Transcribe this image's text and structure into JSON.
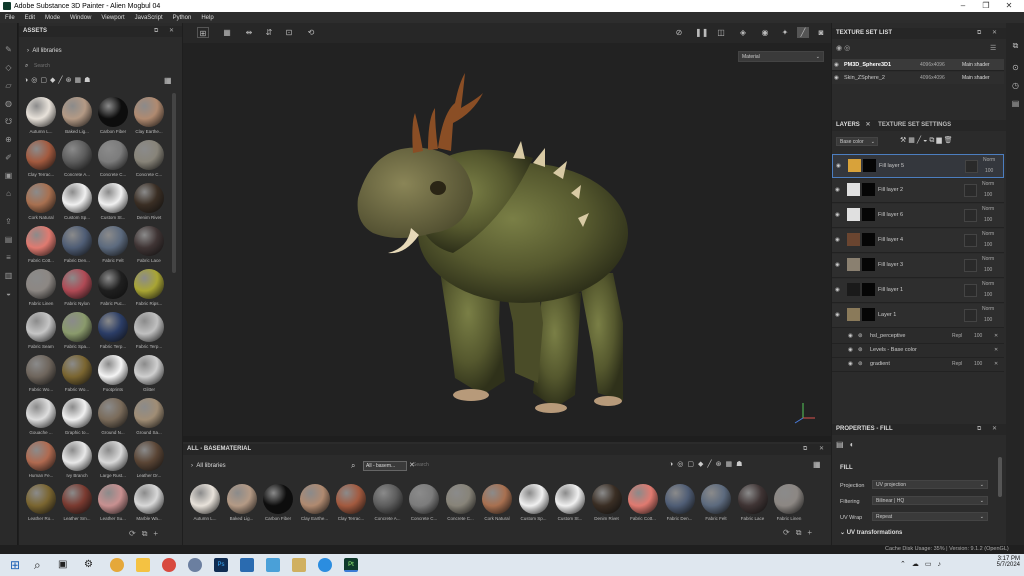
{
  "window": {
    "title": "Adobe Substance 3D Painter - Alien Mogbul 04"
  },
  "menu": [
    "File",
    "Edit",
    "Mode",
    "Window",
    "Viewport",
    "JavaScript",
    "Python",
    "Help"
  ],
  "assets": {
    "title": "ASSETS",
    "library": "All libraries",
    "search_placeholder": "Search",
    "items": [
      {
        "label": "Autumn L...",
        "color": "#e8e2da"
      },
      {
        "label": "Baked Lig...",
        "color": "#b49a85"
      },
      {
        "label": "Carbon Fiber",
        "color": "#0d0d0d"
      },
      {
        "label": "Clay Earthe...",
        "color": "#b08a70"
      },
      {
        "label": "Clay Terrac...",
        "color": "#a35a3f"
      },
      {
        "label": "Concrete A...",
        "color": "#5d5d5d"
      },
      {
        "label": "Concrete C...",
        "color": "#7c7c7c"
      },
      {
        "label": "Concrete C...",
        "color": "#888479"
      },
      {
        "label": "Cork Natural",
        "color": "#a87050"
      },
      {
        "label": "Custom Sp...",
        "color": "#f0f0f0"
      },
      {
        "label": "Custom St...",
        "color": "#f0f0f0"
      },
      {
        "label": "Denim Rivet",
        "color": "#3a2e24"
      },
      {
        "label": "Fabric Cott...",
        "color": "#e07a70"
      },
      {
        "label": "Fabric Den...",
        "color": "#4f5d75"
      },
      {
        "label": "Fabric Felt",
        "color": "#5c6a7e"
      },
      {
        "label": "Fabric Lace",
        "color": "#3f3434"
      },
      {
        "label": "Fabric Linen",
        "color": "#8c8783"
      },
      {
        "label": "Fabric Nylon",
        "color": "#b04a55"
      },
      {
        "label": "Fabric Puc...",
        "color": "#1f1f1f"
      },
      {
        "label": "Fabric Rips...",
        "color": "#a9a534"
      },
      {
        "label": "Fabric Seam",
        "color": "#c5c5c5"
      },
      {
        "label": "Fabric Spa...",
        "color": "#8a9a6c"
      },
      {
        "label": "Fabric Terp...",
        "color": "#2b3d66"
      },
      {
        "label": "Fabric Terp...",
        "color": "#c0c0c0"
      },
      {
        "label": "Fabric Wo...",
        "color": "#6e655c"
      },
      {
        "label": "Fabric Wo...",
        "color": "#7a6530"
      },
      {
        "label": "Footprints",
        "color": "#f4f4f4"
      },
      {
        "label": "Glitter",
        "color": "#cfcfcf"
      },
      {
        "label": "Gouache ...",
        "color": "#dedede"
      },
      {
        "label": "Graphic to...",
        "color": "#f0f0f0"
      },
      {
        "label": "Ground N...",
        "color": "#7a6b5a"
      },
      {
        "label": "Ground Sa...",
        "color": "#a08d75"
      },
      {
        "label": "Human Fe...",
        "color": "#b06a50"
      },
      {
        "label": "Ivy Branch",
        "color": "#e8e8e8"
      },
      {
        "label": "Large Rust...",
        "color": "#d8d8d8"
      },
      {
        "label": "Leather Dr...",
        "color": "#5a4535"
      },
      {
        "label": "Leather Ro...",
        "color": "#7a6530"
      },
      {
        "label": "Leather Sm...",
        "color": "#7a3a30"
      },
      {
        "label": "Leather Su...",
        "color": "#c89090"
      },
      {
        "label": "Marble Wa...",
        "color": "#d8d8d8"
      }
    ]
  },
  "viewport": {
    "mode": "Material"
  },
  "shelf": {
    "title": "ALL - BASEMATERIAL",
    "library": "All libraries",
    "filter": "All - basem...",
    "search_placeholder": "Search",
    "items": [
      {
        "label": "Autumn L...",
        "color": "#e8e2da"
      },
      {
        "label": "Baked Lig...",
        "color": "#b49a85"
      },
      {
        "label": "Carbon Fiber",
        "color": "#0d0d0d"
      },
      {
        "label": "Clay Earthe...",
        "color": "#b08a70"
      },
      {
        "label": "Clay Terrac...",
        "color": "#a35a3f"
      },
      {
        "label": "Concrete A...",
        "color": "#5d5d5d"
      },
      {
        "label": "Concrete C...",
        "color": "#7c7c7c"
      },
      {
        "label": "Concrete C...",
        "color": "#888479"
      },
      {
        "label": "Cork Natural",
        "color": "#a87050"
      },
      {
        "label": "Custom Sp...",
        "color": "#f0f0f0"
      },
      {
        "label": "Custom St...",
        "color": "#f0f0f0"
      },
      {
        "label": "Denim Rivet",
        "color": "#3a2e24"
      },
      {
        "label": "Fabric Cott...",
        "color": "#e07a70"
      },
      {
        "label": "Fabric Den...",
        "color": "#4f5d75"
      },
      {
        "label": "Fabric Felt",
        "color": "#5c6a7e"
      },
      {
        "label": "Fabric Lace",
        "color": "#3f3434"
      },
      {
        "label": "Fabric Linen",
        "color": "#8c8783"
      }
    ]
  },
  "texture_set_list": {
    "title": "TEXTURE SET LIST",
    "sets": [
      {
        "name": "PM3D_Sphere3D1",
        "size": "4096x4096",
        "shader": "Main shader"
      },
      {
        "name": "Skin_ZSphere_2",
        "size": "4096x4096",
        "shader": "Main shader"
      }
    ]
  },
  "layers": {
    "tab_layers": "LAYERS",
    "tab_settings": "TEXTURE SET SETTINGS",
    "channel": "Base color",
    "items": [
      {
        "name": "Fill layer 5",
        "blend": "Norm",
        "opacity": "100"
      },
      {
        "name": "Fill layer 2",
        "blend": "Norm",
        "opacity": "100"
      },
      {
        "name": "Fill layer 6",
        "blend": "Norm",
        "opacity": "100"
      },
      {
        "name": "Fill layer 4",
        "blend": "Norm",
        "opacity": "100"
      },
      {
        "name": "Fill layer 3",
        "blend": "Norm",
        "opacity": "100"
      },
      {
        "name": "Fill layer 1",
        "blend": "Norm",
        "opacity": "100"
      },
      {
        "name": "Layer 1",
        "blend": "Norm",
        "opacity": "100"
      }
    ],
    "effects": [
      {
        "name": "hsl_perceptive",
        "blend": "Repl",
        "opacity": "100"
      },
      {
        "name": "Levels - Base color",
        "blend": "",
        "opacity": ""
      },
      {
        "name": "gradient",
        "blend": "Repl",
        "opacity": "100"
      }
    ]
  },
  "properties": {
    "title": "PROPERTIES - FILL",
    "section": "FILL",
    "rows": [
      {
        "label": "Projection",
        "value": "UV projection"
      },
      {
        "label": "Filtering",
        "value": "Bilinear | HQ"
      },
      {
        "label": "UV Wrap",
        "value": "Repeat"
      }
    ],
    "subsection": "UV transformations"
  },
  "status": {
    "text": "Cache Disk Usage:   35% | Version: 9.1.2 (OpenGL)"
  },
  "taskbar": {
    "time": "3:17 PM",
    "date": "5/7/2024"
  }
}
